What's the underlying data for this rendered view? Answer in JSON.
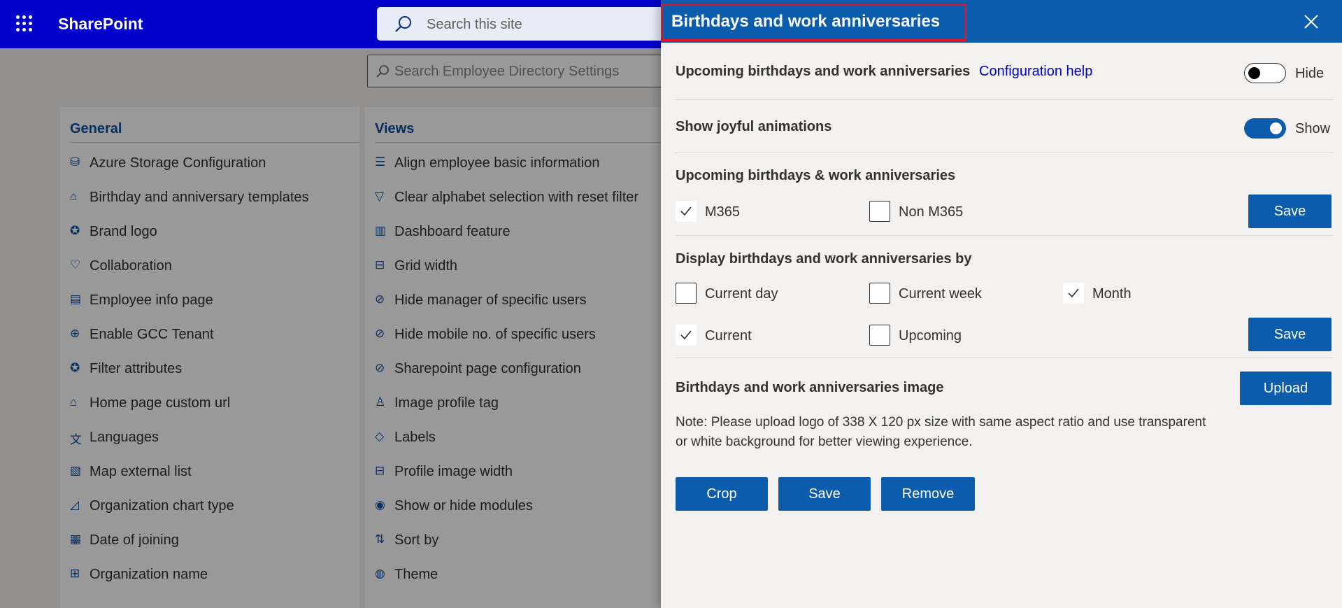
{
  "app": {
    "name": "SharePoint"
  },
  "site_search": {
    "placeholder": "Search this site"
  },
  "settings_search": {
    "placeholder": "Search Employee Directory Settings"
  },
  "general": {
    "heading": "General",
    "items": [
      {
        "label": "Azure Storage Configuration",
        "icon": "database-icon"
      },
      {
        "label": "Birthday and anniversary templates",
        "icon": "cake-icon"
      },
      {
        "label": "Brand logo",
        "icon": "badge-icon"
      },
      {
        "label": "Collaboration",
        "icon": "handshake-icon"
      },
      {
        "label": "Employee info page",
        "icon": "person-document-icon"
      },
      {
        "label": "Enable GCC Tenant",
        "icon": "globe-icon"
      },
      {
        "label": "Filter attributes",
        "icon": "badge-icon"
      },
      {
        "label": "Home page custom url",
        "icon": "home-icon"
      },
      {
        "label": "Languages",
        "icon": "translate-icon"
      },
      {
        "label": "Map external list",
        "icon": "map-list-icon"
      },
      {
        "label": "Organization chart type",
        "icon": "area-chart-icon"
      },
      {
        "label": "Date of joining",
        "icon": "calendar-clock-icon"
      },
      {
        "label": "Organization name",
        "icon": "org-chart-icon"
      }
    ]
  },
  "views": {
    "heading": "Views",
    "items": [
      {
        "label": "Align employee basic information",
        "icon": "align-left-icon"
      },
      {
        "label": "Clear alphabet selection with reset filter",
        "icon": "filter-icon"
      },
      {
        "label": "Dashboard feature",
        "icon": "bar-chart-icon"
      },
      {
        "label": "Grid width",
        "icon": "grid-icon"
      },
      {
        "label": "Hide manager of specific users",
        "icon": "eye-off-icon"
      },
      {
        "label": "Hide mobile no. of specific users",
        "icon": "eye-off-icon"
      },
      {
        "label": "Sharepoint page configuration",
        "icon": "eye-off-icon"
      },
      {
        "label": "Image profile tag",
        "icon": "person-icon"
      },
      {
        "label": "Labels",
        "icon": "tag-icon"
      },
      {
        "label": "Profile image width",
        "icon": "grid-icon"
      },
      {
        "label": "Show or hide modules",
        "icon": "eye-icon"
      },
      {
        "label": "Sort by",
        "icon": "sort-icon"
      },
      {
        "label": "Theme",
        "icon": "palette-icon"
      }
    ]
  },
  "panel": {
    "title": "Birthdays and work anniversaries",
    "upcoming": {
      "label": "Upcoming birthdays and work anniversaries",
      "help_link": "Configuration help",
      "toggle_on": false,
      "toggle_label": "Hide"
    },
    "animations": {
      "label": "Show joyful animations",
      "toggle_on": true,
      "toggle_label": "Show"
    },
    "audience": {
      "heading": "Upcoming birthdays & work anniversaries",
      "options": [
        {
          "label": "M365",
          "checked": true
        },
        {
          "label": "Non M365",
          "checked": false
        }
      ],
      "save_label": "Save"
    },
    "display_by": {
      "heading": "Display birthdays and work anniversaries by",
      "period_options": [
        {
          "label": "Current day",
          "checked": false
        },
        {
          "label": "Current week",
          "checked": false
        },
        {
          "label": "Month",
          "checked": true
        }
      ],
      "time_options": [
        {
          "label": "Current",
          "checked": true
        },
        {
          "label": "Upcoming",
          "checked": false
        }
      ],
      "save_label": "Save"
    },
    "image": {
      "heading": "Birthdays and work anniversaries image",
      "upload_label": "Upload",
      "note": "Note: Please upload logo of 338 X 120 px size with same aspect ratio and use transparent or white background for better viewing experience.",
      "crop_label": "Crop",
      "save_label": "Save",
      "remove_label": "Remove"
    }
  },
  "colors": {
    "topbar": "#0000c8",
    "panel_header": "#0b5cad",
    "button": "#0b5cad",
    "link": "#0000c8",
    "highlight_box": "#e81123"
  }
}
